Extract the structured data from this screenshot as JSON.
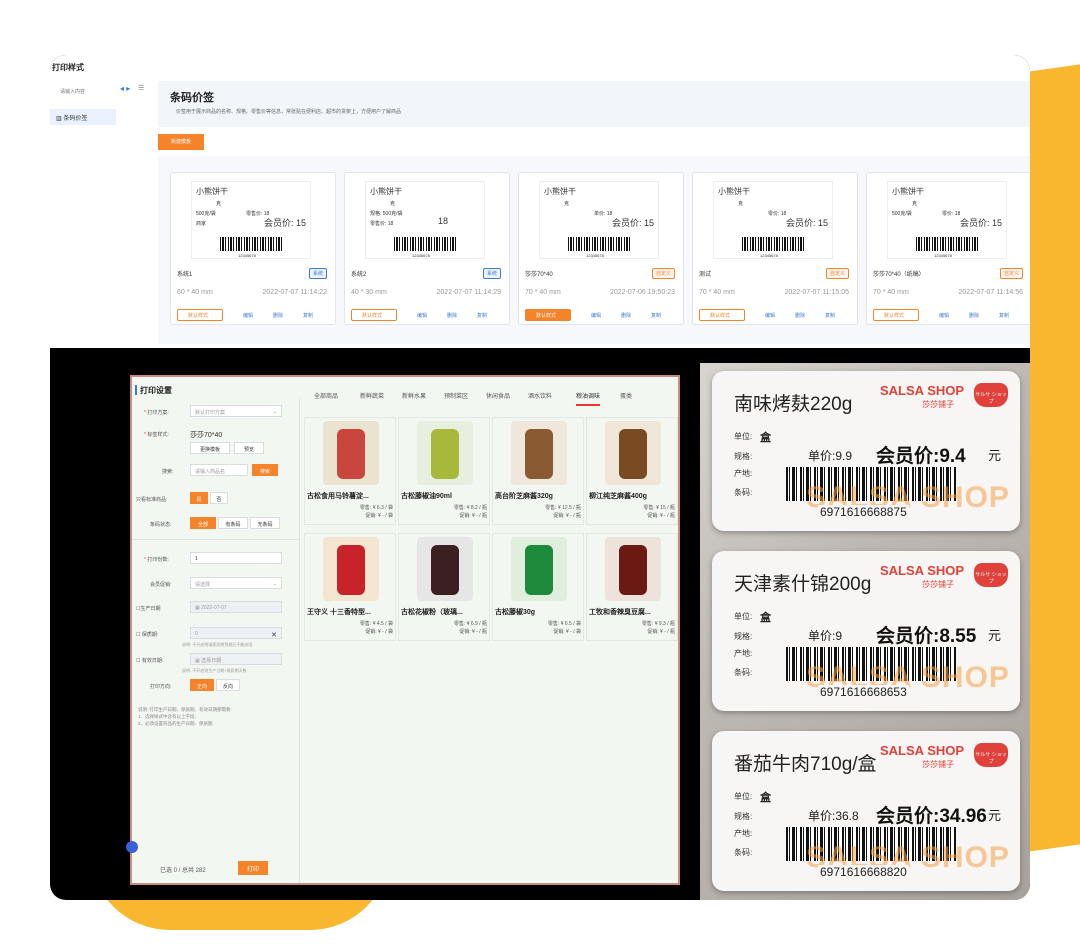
{
  "top": {
    "window_title": "打印样式",
    "search_placeholder": "请输入内容",
    "sidebar_item": "条码价签",
    "main_title": "条码价签",
    "main_desc": "价签用于展示商品的名称、规格、零售价等信息，常张贴在便利店、超市的货架上，方便用户了解商品",
    "new_template": "新建模板",
    "templates": [
      {
        "title": "小熊饼干",
        "line1": "克",
        "line2": "500克/袋",
        "line3": "商家",
        "retail": "零售价: 18",
        "member": "会员价: 15",
        "barcode": "12345678",
        "name": "系统1",
        "badge": "系统",
        "size": "60 * 40 mm",
        "time": "2022-07-07 11:14:22",
        "default_label": "默认样式",
        "edit": "编辑",
        "delete": "删除",
        "copy": "复制",
        "is_default": false,
        "badge_type": "sys"
      },
      {
        "title": "小熊饼干",
        "line1": "克",
        "line2": "规格: 500克/袋",
        "line3": "零售价: 18",
        "retail": "",
        "member": "18",
        "barcode": "12345678",
        "name": "系统2",
        "badge": "系统",
        "size": "40 * 30 mm",
        "time": "2022-07-07 11:14:29",
        "default_label": "默认样式",
        "edit": "编辑",
        "delete": "删除",
        "copy": "复制",
        "is_default": false,
        "badge_type": "sys"
      },
      {
        "title": "小熊饼干",
        "line1": "克",
        "line2": "",
        "line3": "",
        "retail": "单价: 18",
        "member": "会员价: 15",
        "barcode": "12345678",
        "name": "莎莎70*40",
        "badge": "自定义",
        "size": "70 * 40 mm",
        "time": "2022-07-06 19:50:23",
        "default_label": "默认样式",
        "edit": "编辑",
        "delete": "删除",
        "copy": "复制",
        "is_default": true,
        "badge_type": "cus"
      },
      {
        "title": "小熊饼干",
        "line1": "克",
        "line2": "",
        "line3": "",
        "retail": "零价: 18",
        "member": "会员价: 15",
        "barcode": "12345678",
        "name": "测试",
        "badge": "自定义",
        "size": "70 * 40 mm",
        "time": "2022-07-07 11:15:05",
        "default_label": "默认样式",
        "edit": "编辑",
        "delete": "删除",
        "copy": "复制",
        "is_default": false,
        "badge_type": "cus"
      },
      {
        "title": "小熊饼干",
        "line1": "克",
        "line2": "500克/袋",
        "line3": "",
        "retail": "零价: 18",
        "member": "会员价: 15",
        "barcode": "12345678",
        "name": "莎莎70*40（纸稿）",
        "badge": "自定义",
        "size": "70 * 40 mm",
        "time": "2022-07-07 11:14:56",
        "default_label": "默认样式",
        "edit": "编辑",
        "delete": "删除",
        "copy": "复制",
        "is_default": false,
        "badge_type": "cus"
      }
    ]
  },
  "print": {
    "title": "打印设置",
    "plan_label": "打印方案:",
    "plan_value": "默认打印方案",
    "style_label": "标签样式:",
    "style_value": "莎莎70*40",
    "change_tpl": "更换模板",
    "preview": "预览",
    "search_label": "搜索:",
    "search_placeholder": "请输入商品名",
    "search_btn": "搜索",
    "show_label": "只看标准商品:",
    "yes": "是",
    "no": "否",
    "barcode_label": "条码状态:",
    "bc_all": "全部",
    "bc_has": "有条码",
    "bc_none": "无条码",
    "copies_label": "打印份数:",
    "copies_value": "1",
    "promo_label": "会员促销:",
    "promo_value": "请选择",
    "prod_date_label": "生产日期",
    "prod_date_value": "2022-07-07",
    "shelf_label": "保质期:",
    "shelf_value": "0",
    "shelf_note": "说明: 不开启则填保质期到期后不能启用",
    "expiry_label": "有效日期:",
    "expiry_value": "选择日期",
    "expiry_note": "说明: 不开启则生产日期+保质期天数",
    "dir_label": "打印方向:",
    "dir_h": "正向",
    "dir_v": "反向",
    "help1": "说明: 打印生产日期、保质期、有效日期都需要:",
    "help2": "1、选择样式中含有以上字段;",
    "help3": "2、必须设置商品的生产日期、保质期",
    "footer": "已选 0 / 总共 282",
    "print_btn": "打印",
    "tabs": [
      "全部商品",
      "新鲜蔬菜",
      "新鲜水果",
      "预制菜区",
      "休闲食品",
      "酒水饮料",
      "粮油调味",
      "蛋类"
    ],
    "active_tab": 6,
    "products": [
      {
        "name": "古松食用马铃薯淀...",
        "retail": "零售: ¥ 6.3 / 袋",
        "promo": "促销: ¥ - / 袋",
        "color": "#e9e3d0",
        "accent": "#c8463b"
      },
      {
        "name": "古松藤椒油90ml",
        "retail": "零售: ¥ 8.2 / 瓶",
        "promo": "促销: ¥ - / 瓶",
        "color": "#e6efe0",
        "accent": "#a8b83a"
      },
      {
        "name": "高台阶芝麻酱320g",
        "retail": "零售: ¥ 12.5 / 瓶",
        "promo": "促销: ¥ - / 瓶",
        "color": "#efe7dc",
        "accent": "#8a5a32"
      },
      {
        "name": "柳江纯芝麻酱400g",
        "retail": "零售: ¥ 15 / 瓶",
        "promo": "促销: ¥ - / 瓶",
        "color": "#efe6d8",
        "accent": "#7a4a22"
      },
      {
        "name": "王守义 十三香特型...",
        "retail": "零售: ¥ 4.5 / 袋",
        "promo": "促销: ¥ - / 袋",
        "color": "#f3e5d0",
        "accent": "#c8222a"
      },
      {
        "name": "古松花椒粉（玻璃...",
        "retail": "零售: ¥ 6.9 / 瓶",
        "promo": "促销: ¥ - / 瓶",
        "color": "#e6e6e6",
        "accent": "#3a2020"
      },
      {
        "name": "古松藤椒30g",
        "retail": "零售: ¥ 6.5 / 袋",
        "promo": "促销: ¥ - / 袋",
        "color": "#dfeedd",
        "accent": "#1c8a3a"
      },
      {
        "name": "工牧和香辣臭豆腐...",
        "retail": "零售: ¥ 9.3 / 瓶",
        "promo": "促销: ¥ - / 瓶",
        "color": "#eee3da",
        "accent": "#6a1a12"
      }
    ]
  },
  "photo": {
    "labels": [
      {
        "title": "南味烤麸220g",
        "shop": "SALSA SHOP",
        "shop_cn": "莎莎铺子",
        "unit_k": "单位:",
        "unit_v": "盒",
        "spec_k": "规格:",
        "origin_k": "产地:",
        "barcode_k": "条码:",
        "unit_price": "单价:9.9",
        "member": "会员价:9.4",
        "yuan": "元",
        "barcode": "6971616668875",
        "watermark": "SALSA SHOP"
      },
      {
        "title": "天津素什锦200g",
        "shop": "SALSA SHOP",
        "shop_cn": "莎莎铺子",
        "unit_k": "单位:",
        "unit_v": "盒",
        "spec_k": "规格:",
        "origin_k": "产地:",
        "barcode_k": "条码:",
        "unit_price": "单价:9",
        "member": "会员价:8.55",
        "yuan": "元",
        "barcode": "6971616668653",
        "watermark": "SALSA SHOP"
      },
      {
        "title": "番茄牛肉710g/盒",
        "shop": "SALSA SHOP",
        "shop_cn": "莎莎铺子",
        "unit_k": "单位:",
        "unit_v": "盒",
        "spec_k": "规格:",
        "origin_k": "产地:",
        "barcode_k": "条码:",
        "unit_price": "单价:36.8",
        "member": "会员价:34.96",
        "yuan": "元",
        "barcode": "6971616668820",
        "watermark": "SALSA SHOP"
      }
    ],
    "pot_text": "サルサ ショップ"
  },
  "colors": {
    "accent": "#f5832a",
    "blue": "#3a7bd5",
    "yellow": "#f9b62f",
    "red": "#e0413a"
  }
}
